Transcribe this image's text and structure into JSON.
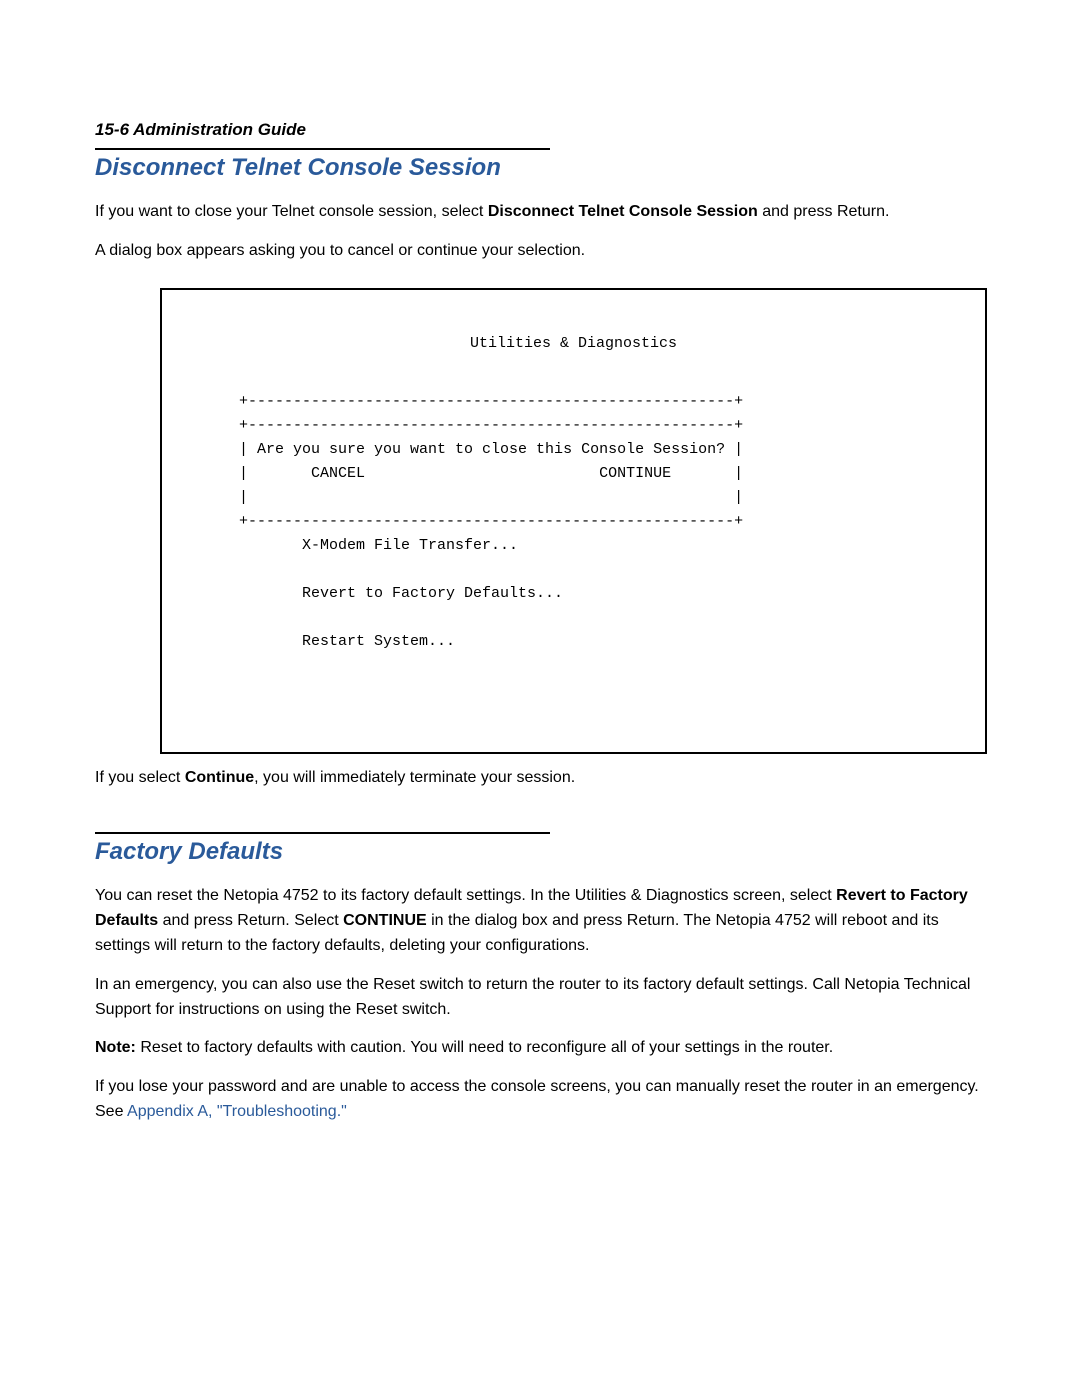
{
  "page_header": "15-6  Administration Guide",
  "sections": {
    "s1": {
      "heading": "Disconnect Telnet Console Session",
      "p1_a": "If you want to close your Telnet console session, select ",
      "p1_b_bold": "Disconnect Telnet Console Session",
      "p1_c": " and press Return.",
      "p2": "A dialog box appears asking you to cancel or continue your selection.",
      "p_after_a": "If you select ",
      "p_after_b_bold": "Continue",
      "p_after_c": ", you will immediately terminate your session."
    },
    "terminal": {
      "title": "Utilities & Diagnostics",
      "line_top": "       +------------------------------------------------------+",
      "line_box1": "       +------------------------------------------------------+",
      "line_q": "       | Are you sure you want to close this Console Session? |",
      "line_opts": "       |       CANCEL                          CONTINUE       |",
      "line_blank": "       |                                                      |",
      "line_box2": "       +------------------------------------------------------+",
      "menu1": "              X-Modem File Transfer...",
      "menu2": "              Revert to Factory Defaults...",
      "menu3": "              Restart System..."
    },
    "s2": {
      "heading": "Factory Defaults",
      "p1_a": "You can reset the Netopia 4752 to its factory default settings. In the Utilities & Diagnostics screen, select ",
      "p1_b_bold": "Revert to Factory Defaults",
      "p1_c": " and press Return. Select ",
      "p1_d_bold": "CONTINUE",
      "p1_e": " in the dialog box and press Return. The Netopia 4752 will reboot and its settings will return to the factory defaults, deleting your configurations.",
      "p2": "In an emergency, you can also use the Reset switch to return the router to its factory default settings. Call Netopia Technical Support for instructions on using the Reset switch.",
      "p3_a_bold": "Note:",
      "p3_b": " Reset to factory defaults with caution. You will need to reconfigure all of your settings in the router.",
      "p4_a": "If you lose your password and are unable to access the console screens, you can manually reset the router in an emergency. See ",
      "p4_b_link": "Appendix A, \"Troubleshooting.\""
    }
  }
}
